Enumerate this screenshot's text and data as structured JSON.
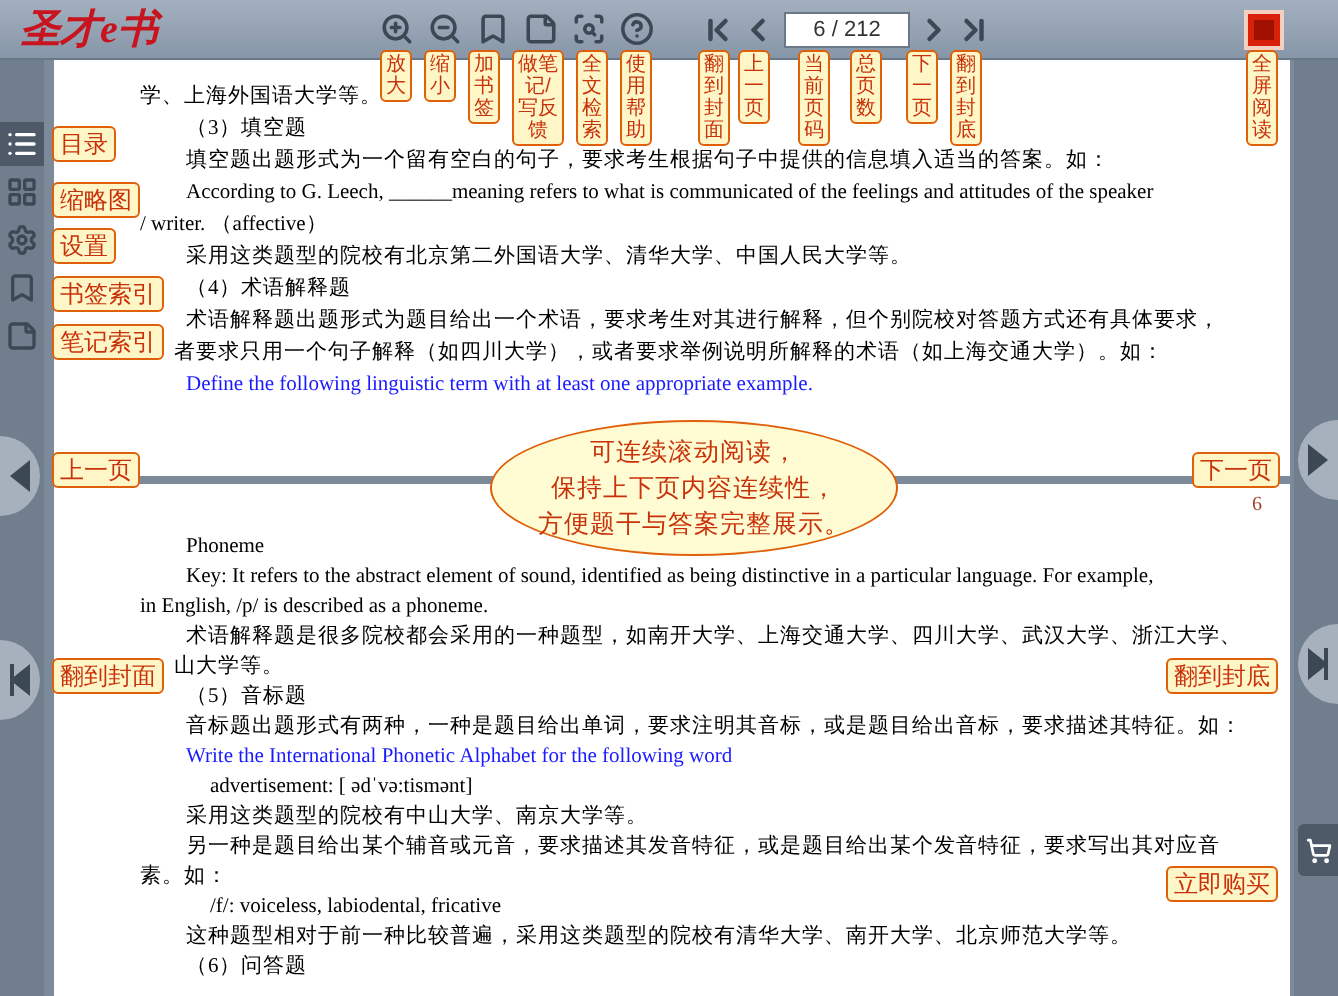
{
  "toolbar": {
    "logo": "圣才e书",
    "page_field": {
      "value": "6 / 212"
    }
  },
  "sidebar": {
    "items": [
      {
        "selected": true
      },
      {
        "selected": false
      },
      {
        "selected": false
      },
      {
        "selected": false
      },
      {
        "selected": false
      }
    ]
  },
  "pages": [
    {
      "lines": [
        {
          "kind": "cont",
          "text": "学、上海外国语大学等。"
        },
        {
          "kind": "para",
          "text": "（3）填空题"
        },
        {
          "kind": "para",
          "text": "填空题出题形式为一个留有空白的句子，要求考生根据句子中提供的信息填入适当的答案。如："
        },
        {
          "kind": "para",
          "text": "According to G. Leech, ______meaning refers to what is communicated of the feelings and attitudes of the speaker"
        },
        {
          "kind": "cont",
          "text": "/ writer. （affective）"
        },
        {
          "kind": "para",
          "text": "采用这类题型的院校有北京第二外国语大学、清华大学、中国人民大学等。"
        },
        {
          "kind": "para",
          "text": "（4）术语解释题"
        },
        {
          "kind": "para",
          "text": "术语解释题出题形式为题目给出一个术语，要求考生对其进行解释，但个别院校对答题方式还有具体要求，"
        },
        {
          "kind": "tail",
          "text": "者要求只用一个句子解释（如四川大学），或者要求举例说明所解释的术语（如上海交通大学）。如："
        },
        {
          "kind": "blue",
          "text": "Define the following linguistic term with at least one appropriate example."
        }
      ]
    },
    {
      "number": "6",
      "lines": [
        {
          "kind": "para",
          "text": "Phoneme"
        },
        {
          "kind": "para",
          "text": "Key: It refers to the abstract element of sound, identified as being distinctive in a particular language. For example,"
        },
        {
          "kind": "cont",
          "text": "in English, /p/ is described as a phoneme."
        },
        {
          "kind": "para",
          "text": "术语解释题是很多院校都会采用的一种题型，如南开大学、上海交通大学、四川大学、武汉大学、浙江大学、"
        },
        {
          "kind": "tail",
          "text": "山大学等。"
        },
        {
          "kind": "para",
          "text": "（5）音标题"
        },
        {
          "kind": "para",
          "text": "音标题出题形式有两种，一种是题目给出单词，要求注明其音标，或是题目给出音标，要求描述其特征。如："
        },
        {
          "kind": "blue",
          "text": "Write the International Phonetic Alphabet for the following word"
        },
        {
          "kind": "example",
          "text": "advertisement: [ ədˈvə:tismənt]"
        },
        {
          "kind": "para",
          "text": "采用这类题型的院校有中山大学、南京大学等。"
        },
        {
          "kind": "para",
          "text": "另一种是题目给出某个辅音或元音，要求描述其发音特征，或是题目给出某个发音特征，要求写出其对应音"
        },
        {
          "kind": "cont",
          "text": "素。如："
        },
        {
          "kind": "example",
          "text": "/f/: voiceless, labiodental, fricative"
        },
        {
          "kind": "para",
          "text": "这种题型相对于前一种比较普遍，采用这类题型的院校有清华大学、南开大学、北京师范大学等。"
        },
        {
          "kind": "para",
          "text": "（6）问答题"
        }
      ]
    }
  ],
  "callouts": {
    "toolbar": [
      "放大",
      "缩小",
      "加书签",
      "做笔记/写反馈",
      "全文检索",
      "使用帮助",
      "翻到封面",
      "上一页",
      "当前页码",
      "总页数",
      "下一页",
      "翻到封底",
      "全屏阅读"
    ],
    "sidebar": [
      "目录",
      "缩略图",
      "设置",
      "书签索引",
      "笔记索引"
    ],
    "left": [
      "上一页",
      "翻到封面"
    ],
    "right": [
      "下一页",
      "翻到封底",
      "立即购买"
    ],
    "bubble": [
      "可连续滚动阅读，",
      "保持上下页内容连续性，",
      "方便题干与答案完整展示。"
    ]
  }
}
